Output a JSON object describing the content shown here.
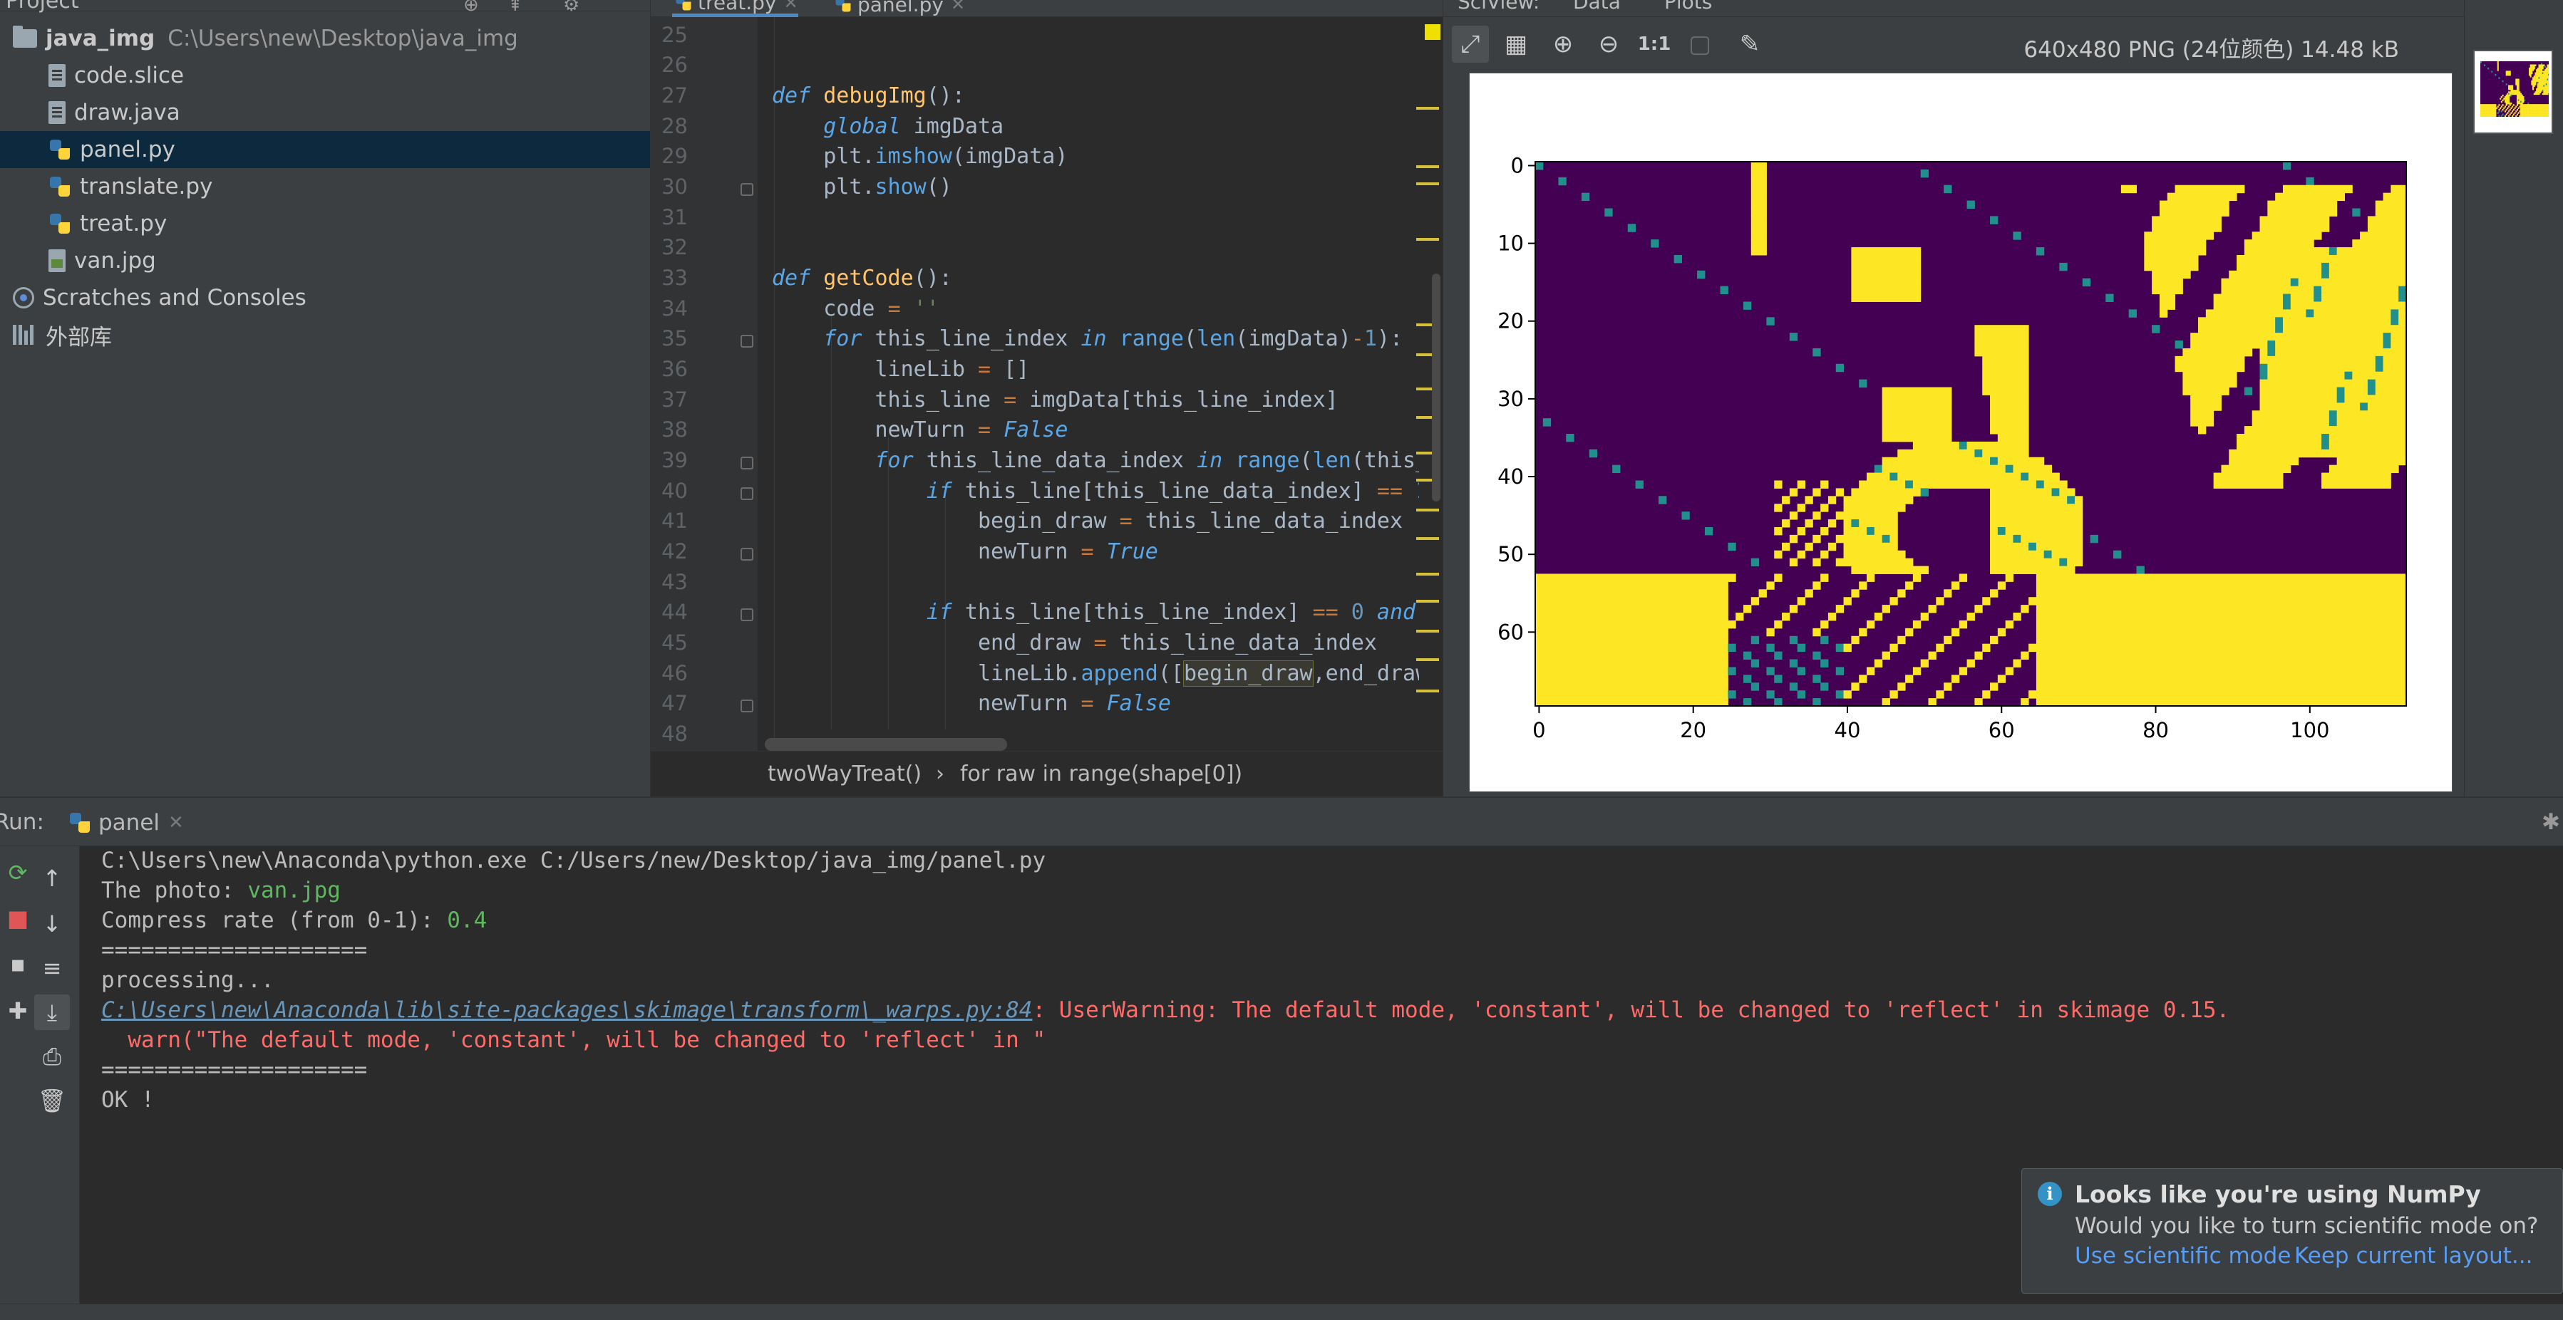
{
  "project": {
    "title": "Project",
    "root": {
      "name": "java_img",
      "path": "C:\\Users\\new\\Desktop\\java_img"
    },
    "files": [
      "code.slice",
      "draw.java",
      "panel.py",
      "translate.py",
      "treat.py",
      "van.jpg"
    ],
    "selected": "panel.py",
    "scratches": "Scratches and Consoles",
    "external_libs": "外部库"
  },
  "editor": {
    "tabs": [
      {
        "label": "treat.py",
        "active": true
      },
      {
        "label": "panel.py",
        "active": false
      }
    ],
    "line_numbers": [
      "25",
      "26",
      "27",
      "28",
      "29",
      "30",
      "31",
      "32",
      "33",
      "34",
      "35",
      "36",
      "37",
      "38",
      "39",
      "40",
      "41",
      "42",
      "43",
      "44",
      "45",
      "46",
      "47",
      "48"
    ],
    "breadcrumb": {
      "fn": "twoWayTreat()",
      "sep": "›",
      "loop": "for raw in range(shape[0])"
    }
  },
  "sciview": {
    "tabs": [
      "SciView:",
      "Data",
      "Plots"
    ],
    "image_info": "640x480 PNG (24位颜色) 14.48 kB",
    "zoom_label": "1:1"
  },
  "chart_data": {
    "type": "heatmap",
    "colormap": "viridis",
    "x_ticks": [
      0,
      20,
      40,
      60,
      80,
      100
    ],
    "y_ticks": [
      0,
      10,
      20,
      30,
      40,
      50,
      60
    ],
    "xlim": [
      -0.5,
      112.5
    ],
    "ylim": [
      69.5,
      -0.5
    ],
    "colors": {
      "low": "#440154",
      "high": "#fde725",
      "mid": "#21908d"
    }
  },
  "run": {
    "label": "Run:",
    "tab": "panel",
    "console": {
      "cmd": "C:\\Users\\new\\Anaconda\\python.exe C:/Users/new/Desktop/java_img/panel.py",
      "photo_prompt": "The photo: ",
      "photo_value": "van.jpg",
      "rate_prompt": "Compress rate (from 0-1): ",
      "rate_value": "0.4",
      "sep1": "====================",
      "processing": "processing...",
      "warn_link": "C:\\Users\\new\\Anaconda\\lib\\site-packages\\skimage\\transform\\_warps.py:84",
      "warn_text": ": UserWarning: The default mode, 'constant', will be changed to 'reflect' in skimage 0.15.",
      "warn_line2": "  warn(\"The default mode, 'constant', will be changed to 'reflect' in \"",
      "sep2": "====================",
      "ok": "OK !"
    }
  },
  "notification": {
    "title": "Looks like you're using NumPy",
    "body": "Would you like to turn scientific mode on?",
    "action1": "Use scientific mode",
    "action2": "Keep current layout..."
  }
}
